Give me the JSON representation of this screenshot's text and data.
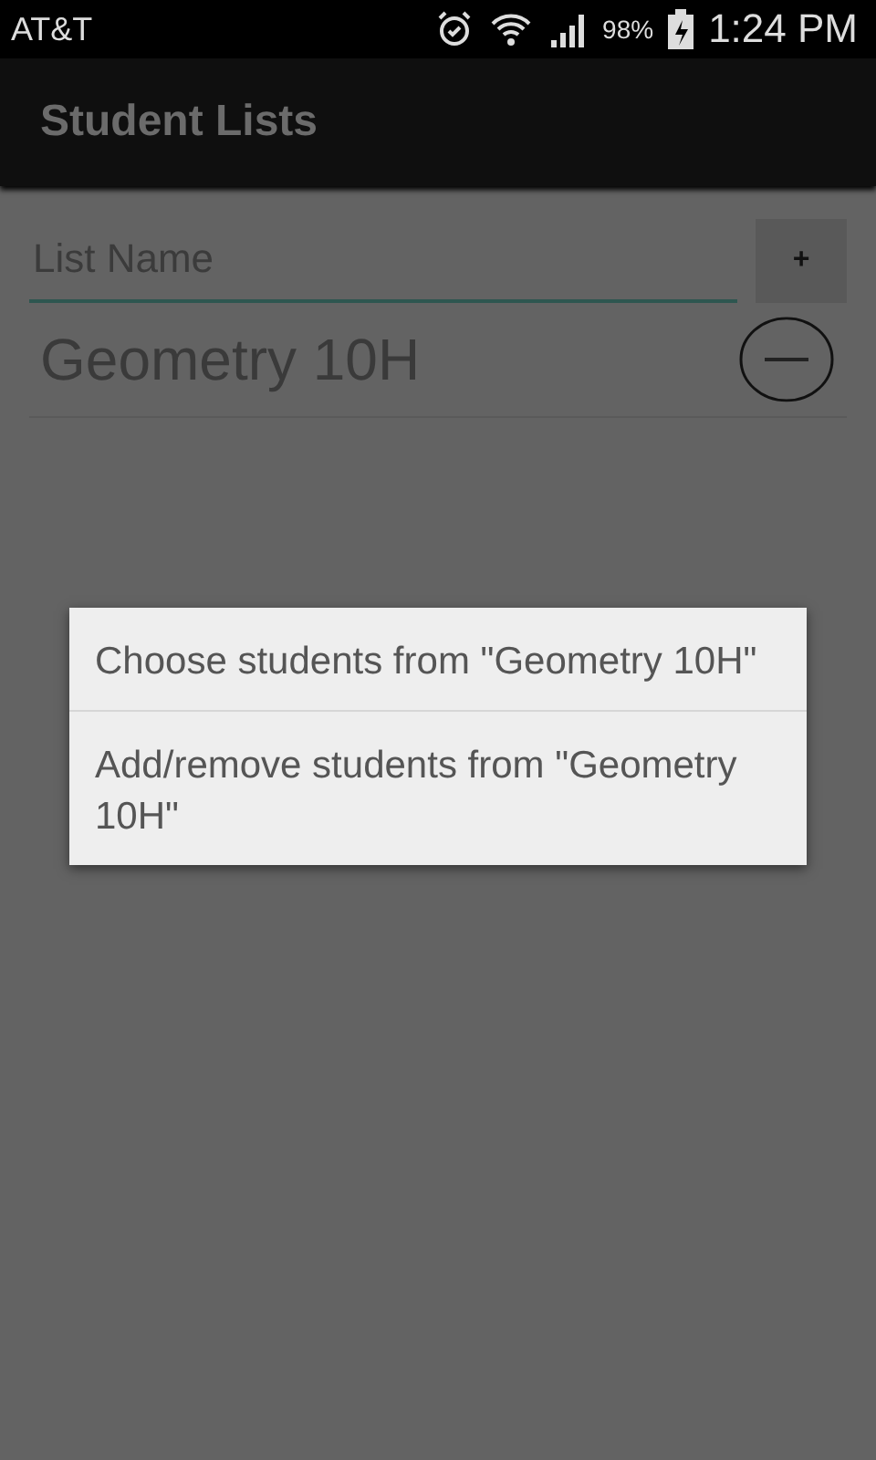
{
  "status_bar": {
    "carrier": "AT&T",
    "battery": "98%",
    "time": "1:24 PM"
  },
  "app_bar": {
    "title": "Student Lists"
  },
  "new_list": {
    "placeholder": "List Name",
    "add_button": "+"
  },
  "lists": [
    {
      "name": "Geometry 10H"
    }
  ],
  "context_menu": [
    {
      "label": "Choose students from \"Geometry 10H\""
    },
    {
      "label": "Add/remove students from \"Geometry 10H\""
    }
  ]
}
